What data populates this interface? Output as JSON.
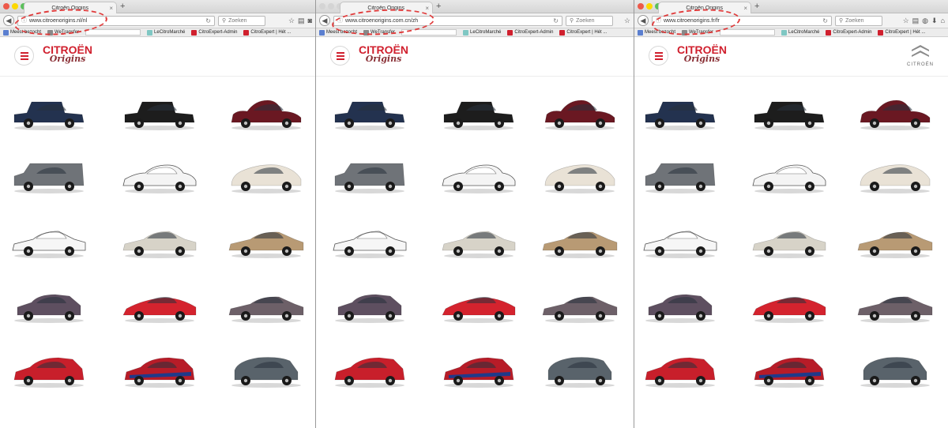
{
  "brand": {
    "logo_line1": "CITROËN",
    "logo_line2": "Origins",
    "chevron_wordmark": "CITROËN"
  },
  "screens": [
    {
      "tab_title": "Citroën Origins",
      "url": "www.citroenorigins.nl/nl",
      "search_placeholder": "Zoeken",
      "bookmarks": [
        "Meest bezocht",
        "WeTransfer"
      ]
    },
    {
      "tab_title": "Citroën Origins",
      "url": "www.citroenorigins.com.cn/zh",
      "search_placeholder": "Zoeken",
      "bookmarks": [
        "Meest bezocht",
        "WeTransfer",
        "LeCitroMarché",
        "CitroExpert-Admin",
        "CitroExpert | Hét ..."
      ]
    },
    {
      "tab_title": "Citroën Origins",
      "url": "www.citroenorigins.fr/fr",
      "search_placeholder": "Zoeken",
      "bookmarks": [
        "Meest bezocht",
        "WeTransfer",
        "LeCitroMarché",
        "CitroExpert-Admin",
        "CitroExpert | Hét ..."
      ]
    }
  ],
  "shared_bookmarks_left": [
    "LeCitroMarché",
    "CitroExpert-Admin",
    "CitroExpert | Hét ..."
  ],
  "colors": {
    "citroen_red": "#d0202e",
    "annotation_red": "#e03c3c"
  },
  "car_models": [
    [
      "navy-sedan",
      "black-sedan",
      "maroon-coupe"
    ],
    [
      "grey-van",
      "white-ds",
      "white-bubble-car"
    ],
    [
      "white-gs",
      "white-gs-2",
      "gold-cx"
    ],
    [
      "mauve-hatchback",
      "red-concept",
      "mauve-xm"
    ],
    [
      "red-xsara",
      "rally-xsara",
      "grey-c3"
    ]
  ]
}
